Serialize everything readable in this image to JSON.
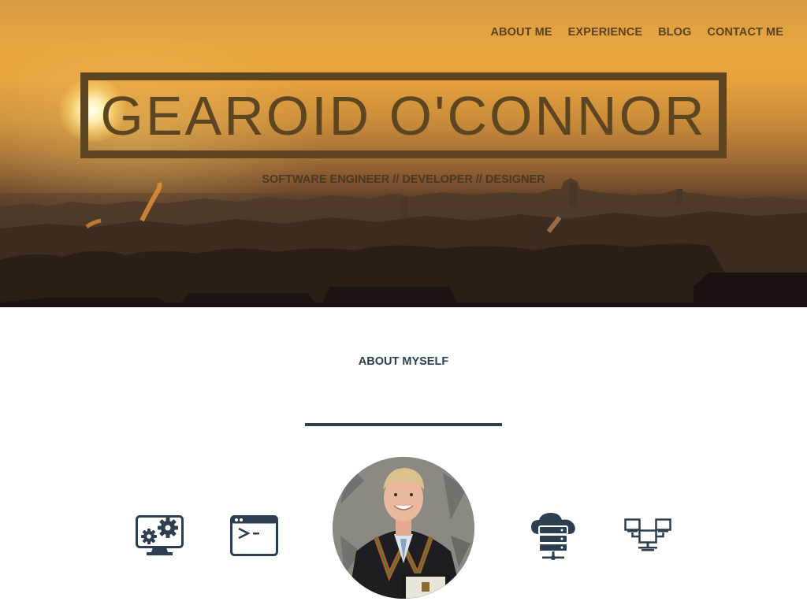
{
  "nav": {
    "items": [
      {
        "label": "ABOUT ME"
      },
      {
        "label": "EXPERIENCE"
      },
      {
        "label": "BLOG"
      },
      {
        "label": "CONTACT ME"
      }
    ]
  },
  "hero": {
    "title": "GEAROID O'CONNOR",
    "subtitle": "SOFTWARE ENGINEER // DEVELOPER // DESIGNER"
  },
  "about": {
    "heading": "ABOUT MYSELF",
    "icons": [
      "computer-settings-icon",
      "terminal-icon",
      "cloud-server-icon",
      "network-icon"
    ]
  },
  "colors": {
    "hero_text": "#5c4520",
    "heading": "#2c3e50",
    "icon": "#2c3e50"
  }
}
